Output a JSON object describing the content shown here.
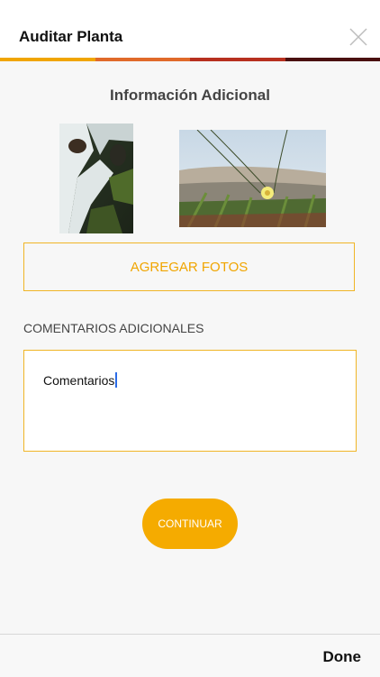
{
  "header": {
    "title": "Auditar Planta",
    "close_icon": "close-icon",
    "stripe_colors": [
      "#f0a500",
      "#e06a2a",
      "#b7301f",
      "#4a1010"
    ]
  },
  "main": {
    "section_title": "Información Adicional",
    "photos": [
      {
        "icon": "waterfall-photo"
      },
      {
        "icon": "dune-flower-photo"
      }
    ],
    "add_photos_label": "AGREGAR FOTOS",
    "comments_label": "COMENTARIOS ADICIONALES",
    "comments_value": "Comentarios",
    "continue_label": "CONTINUAR"
  },
  "keyboard_bar": {
    "done_label": "Done"
  },
  "colors": {
    "accent": "#f0a500",
    "border": "#f0b526",
    "caret": "#2b6ce8"
  }
}
